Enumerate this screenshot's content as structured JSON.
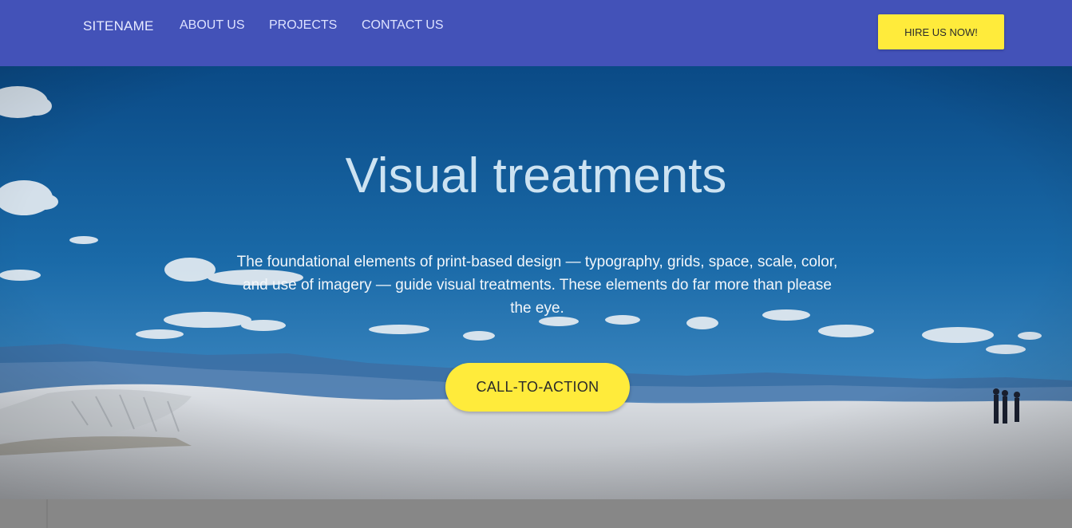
{
  "nav": {
    "brand": "SITENAME",
    "links": [
      "ABOUT US",
      "PROJECTS",
      "CONTACT US"
    ],
    "hire_button": "HIRE US NOW!"
  },
  "hero": {
    "title": "Visual treatments",
    "text": "The foundational elements of print-based design — typography, grids, space, scale, color, and use of imagery — guide visual treatments. These elements do far more than please the eye.",
    "cta": "CALL-TO-ACTION",
    "background": "desert-sky-photo"
  },
  "colors": {
    "nav_bg": "#4352b8",
    "accent": "#ffeb3b",
    "sky_dark": "#0b4f8a",
    "sand": "#d6dadf"
  }
}
